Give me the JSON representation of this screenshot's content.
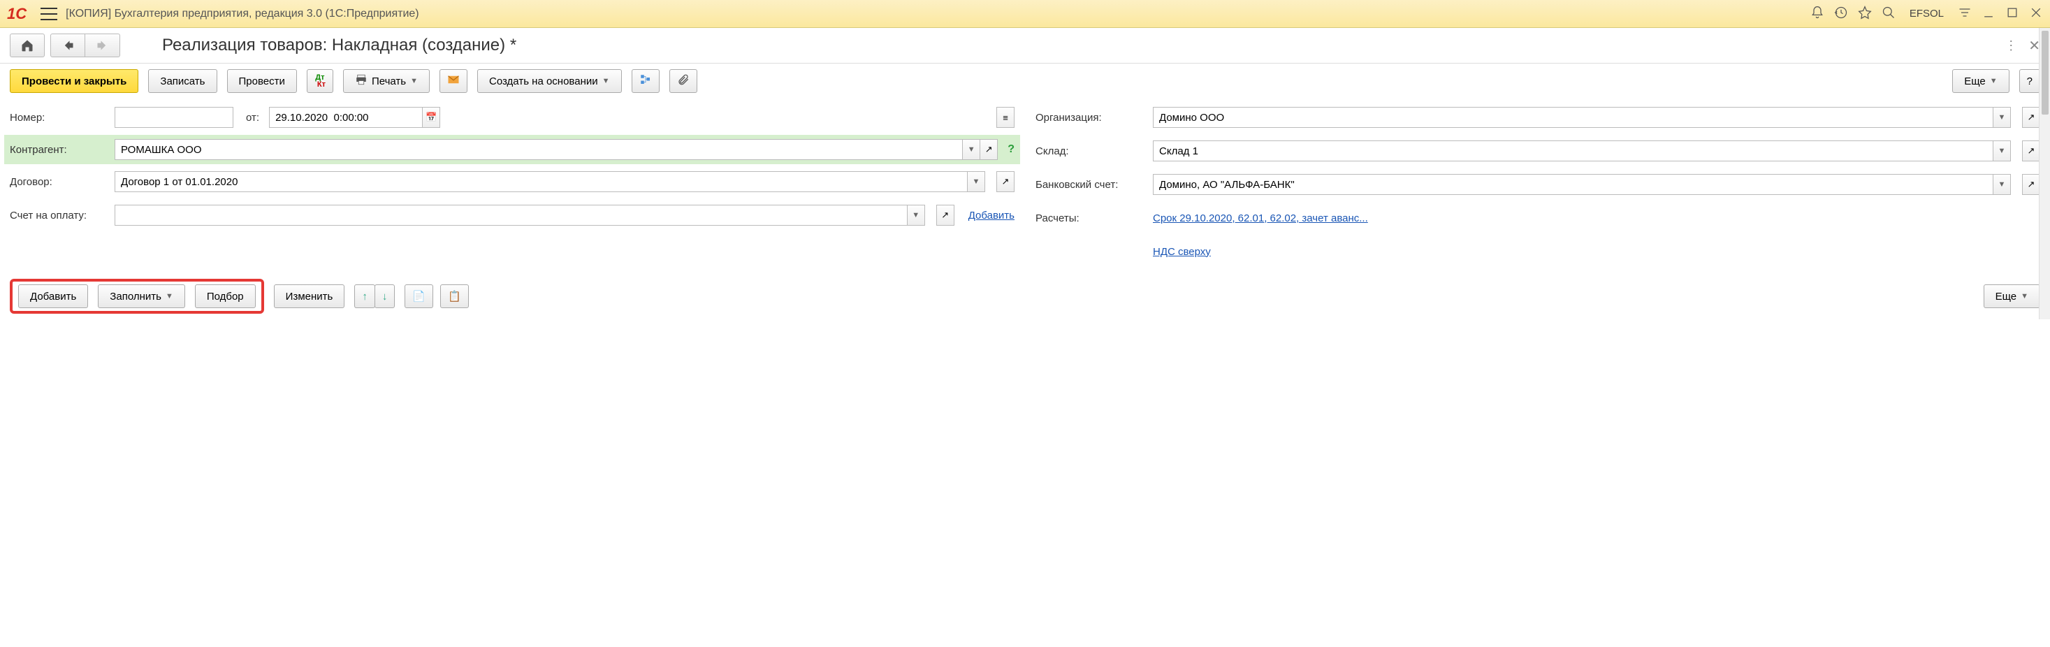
{
  "titlebar": {
    "app_title": "[КОПИЯ] Бухгалтерия предприятия, редакция 3.0  (1С:Предприятие)",
    "user": "EFSOL"
  },
  "page": {
    "title": "Реализация товаров: Накладная (создание) *"
  },
  "toolbar": {
    "post_close": "Провести и закрыть",
    "save": "Записать",
    "post": "Провести",
    "print": "Печать",
    "create_based": "Создать на основании",
    "more": "Еще"
  },
  "form": {
    "left": {
      "number_label": "Номер:",
      "number_value": "",
      "from_label": "от:",
      "date_value": "29.10.2020  0:00:00",
      "counterparty_label": "Контрагент:",
      "counterparty_value": "РОМАШКА ООО",
      "contract_label": "Договор:",
      "contract_value": "Договор 1 от 01.01.2020",
      "invoice_label": "Счет на оплату:",
      "invoice_value": "",
      "add_link": "Добавить"
    },
    "right": {
      "org_label": "Организация:",
      "org_value": "Домино ООО",
      "warehouse_label": "Склад:",
      "warehouse_value": "Склад 1",
      "bank_label": "Банковский счет:",
      "bank_value": "Домино, АО \"АЛЬФА-БАНК\"",
      "calc_label": "Расчеты:",
      "calc_link": "Срок 29.10.2020, 62.01, 62.02, зачет аванс...",
      "vat_link": "НДС сверху"
    }
  },
  "table_toolbar": {
    "add": "Добавить",
    "fill": "Заполнить",
    "pick": "Подбор",
    "edit": "Изменить",
    "more": "Еще"
  }
}
